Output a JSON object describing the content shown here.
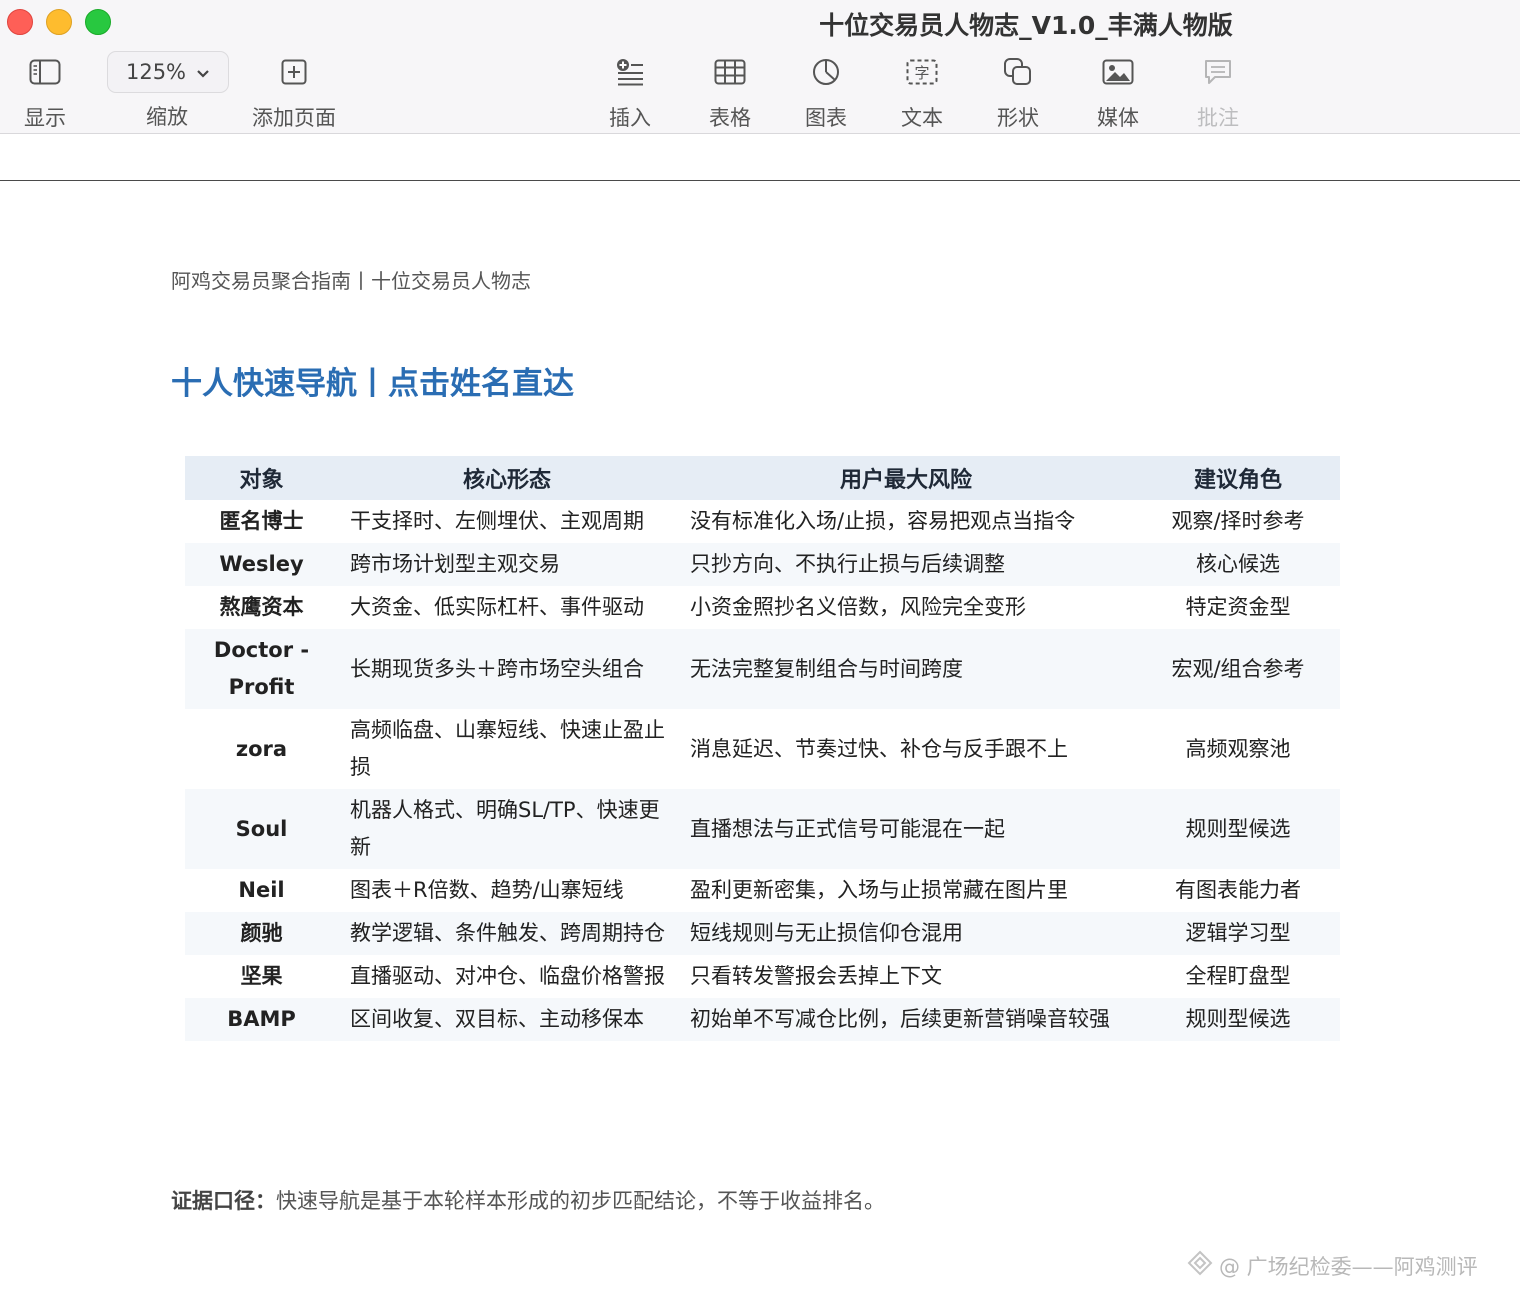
{
  "window": {
    "title": "十位交易员人物志_V1.0_丰满人物版"
  },
  "toolbar": {
    "view_label": "显示",
    "zoom_value": "125%",
    "zoom_label": "缩放",
    "add_page_label": "添加页面",
    "insert_label": "插入",
    "table_label": "表格",
    "chart_label": "图表",
    "text_label": "文本",
    "shape_label": "形状",
    "media_label": "媒体",
    "comment_label": "批注",
    "text_icon_glyph": "字"
  },
  "document": {
    "header": "阿鸡交易员聚合指南丨十位交易员人物志",
    "nav_title": "十人快速导航丨点击姓名直达",
    "table": {
      "headers": [
        "对象",
        "核心形态",
        "用户最大风险",
        "建议角色"
      ],
      "rows": [
        {
          "name": "匿名博士",
          "form": "干支择时、左侧埋伏、主观周期",
          "risk": "没有标准化入场/止损，容易把观点当指令",
          "role": "观察/择时参考"
        },
        {
          "name": "Wesley",
          "form": "跨市场计划型主观交易",
          "risk": "只抄方向、不执行止损与后续调整",
          "role": "核心候选"
        },
        {
          "name": "熬鹰资本",
          "form": "大资金、低实际杠杆、事件驱动",
          "risk": "小资金照抄名义倍数，风险完全变形",
          "role": "特定资金型"
        },
        {
          "name": "Doctor - Profit",
          "form": "长期现货多头＋跨市场空头组合",
          "risk": "无法完整复制组合与时间跨度",
          "role": "宏观/组合参考"
        },
        {
          "name": "zora",
          "form": "高频临盘、山寨短线、快速止盈止损",
          "risk": "消息延迟、节奏过快、补仓与反手跟不上",
          "role": "高频观察池"
        },
        {
          "name": "Soul",
          "form": "机器人格式、明确SL/TP、快速更新",
          "risk": "直播想法与正式信号可能混在一起",
          "role": "规则型候选"
        },
        {
          "name": "Neil",
          "form": "图表＋R倍数、趋势/山寨短线",
          "risk": "盈利更新密集，入场与止损常藏在图片里",
          "role": "有图表能力者"
        },
        {
          "name": "颜驰",
          "form": "教学逻辑、条件触发、跨周期持仓",
          "risk": "短线规则与无止损信仰仓混用",
          "role": "逻辑学习型"
        },
        {
          "name": "坚果",
          "form": "直播驱动、对冲仓、临盘价格警报",
          "risk": "只看转发警报会丢掉上下文",
          "role": "全程盯盘型"
        },
        {
          "name": "BAMP",
          "form": "区间收复、双目标、主动移保本",
          "risk": "初始单不写减仓比例，后续更新营销噪音较强",
          "role": "规则型候选"
        }
      ]
    },
    "evidence_label": "证据口径：",
    "evidence_text": "快速导航是基于本轮样本形成的初步匹配结论，不等于收益排名。"
  },
  "watermark": "@ 广场纪检委——阿鸡测评",
  "colors": {
    "accent": "#2a6db3",
    "header_bg": "#e6edf5",
    "row_alt_bg": "#f5f8fb"
  }
}
